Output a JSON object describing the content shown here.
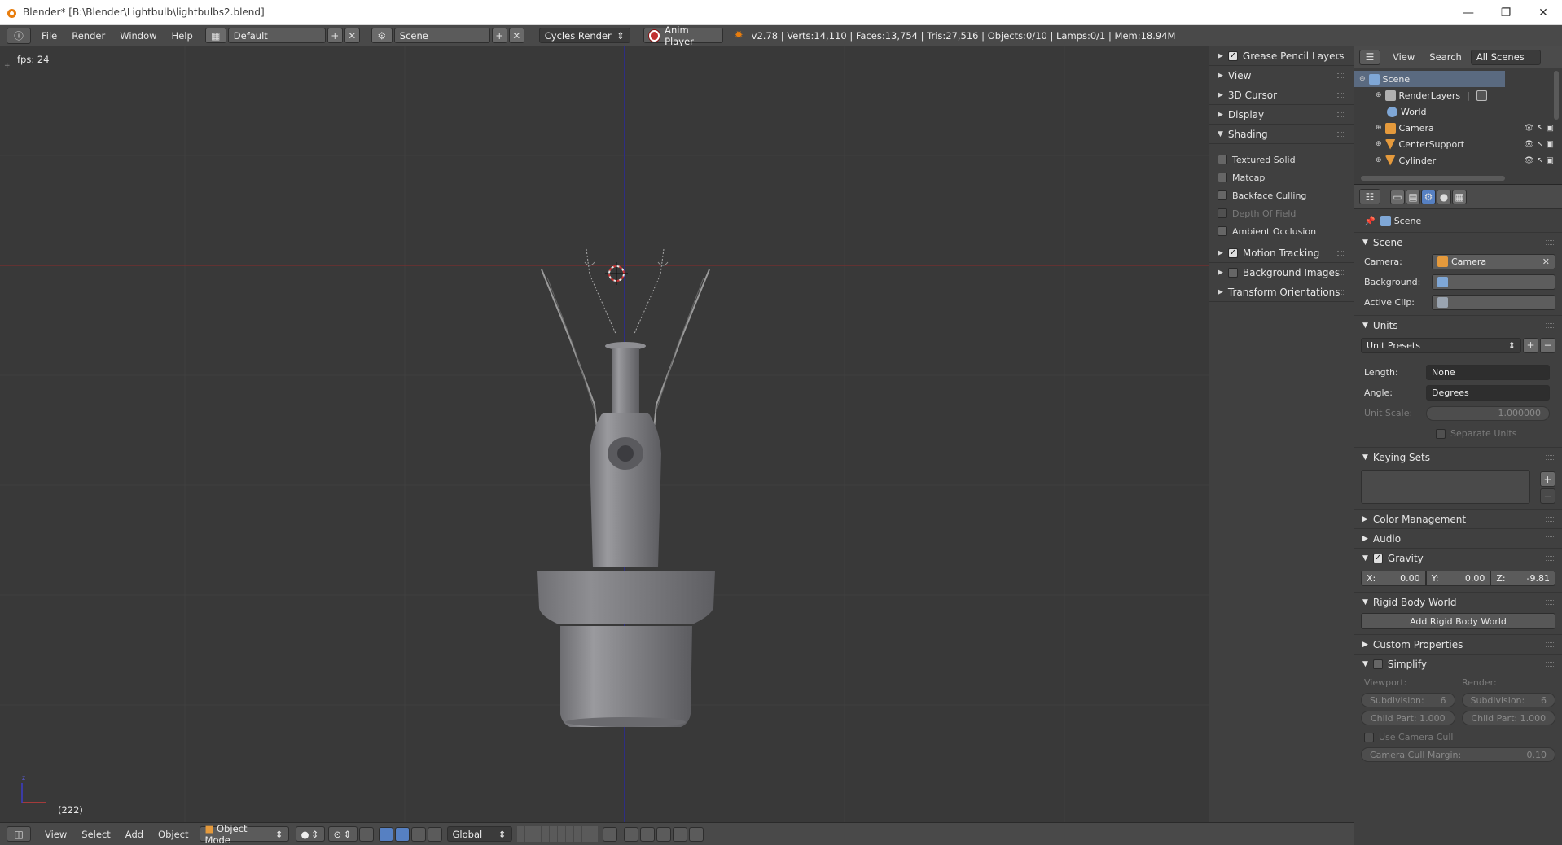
{
  "window": {
    "title": "Blender* [B:\\Blender\\Lightbulb\\lightbulbs2.blend]",
    "controls": [
      "—",
      "❐",
      "✕"
    ]
  },
  "header": {
    "menus": [
      "File",
      "Render",
      "Window",
      "Help"
    ],
    "layout": "Default",
    "scene": "Scene",
    "engine": "Cycles Render",
    "anim_player": "Anim Player",
    "stats": "v2.78 | Verts:14,110 | Faces:13,754 | Tris:27,516 | Objects:0/10 | Lamps:0/1 | Mem:18.94M"
  },
  "viewport": {
    "fps": "fps: 24",
    "frame": "(222)"
  },
  "npanel": {
    "sections": [
      "Grease Pencil Layers",
      "View",
      "3D Cursor",
      "Display",
      "Shading"
    ],
    "shading_options": [
      {
        "label": "Textured Solid",
        "checked": false,
        "enabled": true
      },
      {
        "label": "Matcap",
        "checked": false,
        "enabled": true
      },
      {
        "label": "Backface Culling",
        "checked": false,
        "enabled": true
      },
      {
        "label": "Depth Of Field",
        "checked": false,
        "enabled": false
      },
      {
        "label": "Ambient Occlusion",
        "checked": false,
        "enabled": true
      }
    ],
    "motion_tracking": "Motion Tracking",
    "background_images": "Background Images",
    "transform_orientations": "Transform Orientations"
  },
  "outliner": {
    "view": "View",
    "search": "Search",
    "filter": "All Scenes",
    "items": [
      {
        "name": "Scene",
        "color": "#7fa7d6"
      },
      {
        "name": "RenderLayers",
        "color": "#b0b0b0"
      },
      {
        "name": "World",
        "color": "#7fa7d6"
      },
      {
        "name": "Camera",
        "color": "#e59a3c"
      },
      {
        "name": "CenterSupport",
        "color": "#e59a3c"
      },
      {
        "name": "Cylinder",
        "color": "#e59a3c"
      }
    ]
  },
  "properties": {
    "breadcrumb": "Scene",
    "scene_section": "Scene",
    "camera_label": "Camera:",
    "camera_value": "Camera",
    "background_label": "Background:",
    "active_clip_label": "Active Clip:",
    "units_section": "Units",
    "unit_presets": "Unit Presets",
    "length_label": "Length:",
    "length_value": "None",
    "angle_label": "Angle:",
    "angle_value": "Degrees",
    "unit_scale_label": "Unit Scale:",
    "unit_scale_value": "1.000000",
    "separate_units": "Separate Units",
    "keying_sets": "Keying Sets",
    "color_management": "Color Management",
    "audio": "Audio",
    "gravity": "Gravity",
    "gravity_x": "0.00",
    "gravity_y": "0.00",
    "gravity_z": "-9.81",
    "rigid_body_world": "Rigid Body World",
    "add_rigid_body_world": "Add Rigid Body World",
    "custom_properties": "Custom Properties",
    "simplify": "Simplify",
    "viewport_label": "Viewport:",
    "render_label": "Render:",
    "subdivision_label": "Subdivision:",
    "subdivision_vp": "6",
    "subdivision_rd": "6",
    "child_part_vp": "Child Part: 1.000",
    "child_part_rd": "Child Part: 1.000",
    "use_camera_cull": "Use Camera Cull",
    "camera_cull_margin_label": "Camera Cull Margin:",
    "camera_cull_margin_value": "0.10"
  },
  "footer": {
    "menus": [
      "View",
      "Select",
      "Add",
      "Object"
    ],
    "mode": "Object Mode",
    "orientation": "Global"
  }
}
